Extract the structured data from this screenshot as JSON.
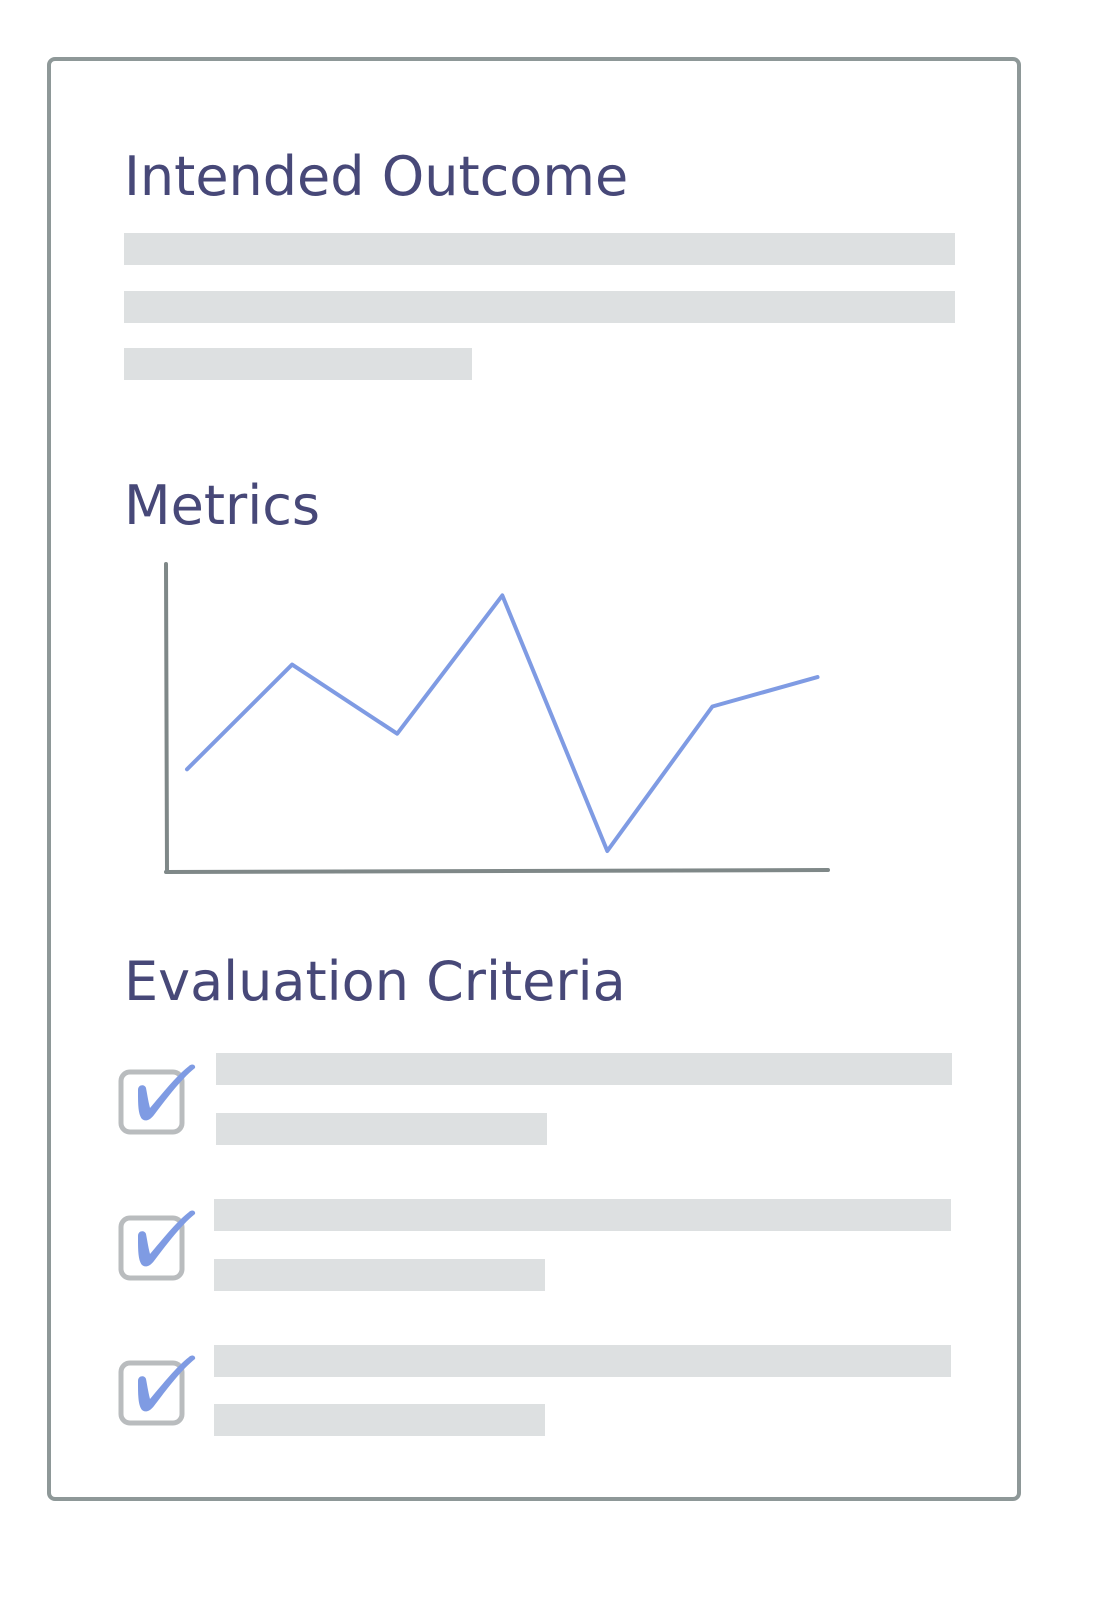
{
  "document": {
    "sections": {
      "intended_outcome": {
        "title": "Intended Outcome"
      },
      "metrics": {
        "title": "Metrics"
      },
      "evaluation_criteria": {
        "title": "Evaluation Criteria"
      }
    }
  },
  "colors": {
    "heading": "#474878",
    "border": "#8e9898",
    "placeholder_bar": "#dde0e1",
    "chart_line": "#7f9be3",
    "axis": "#7f8888",
    "checkmark": "#7f9be3",
    "checkbox_border": "#b9bcbe"
  },
  "icons": {
    "checkbox": "checked-checkbox-icon"
  },
  "chart_data": {
    "type": "line",
    "title": "",
    "xlabel": "",
    "ylabel": "",
    "grid": false,
    "x": [
      0,
      1,
      2,
      3,
      4,
      5,
      6
    ],
    "series": [
      {
        "values": [
          25,
          75,
          42,
          108,
          -14,
          55,
          69
        ]
      }
    ],
    "xlim": [
      -0.2,
      6.1
    ],
    "ylim": [
      -24,
      123
    ]
  }
}
